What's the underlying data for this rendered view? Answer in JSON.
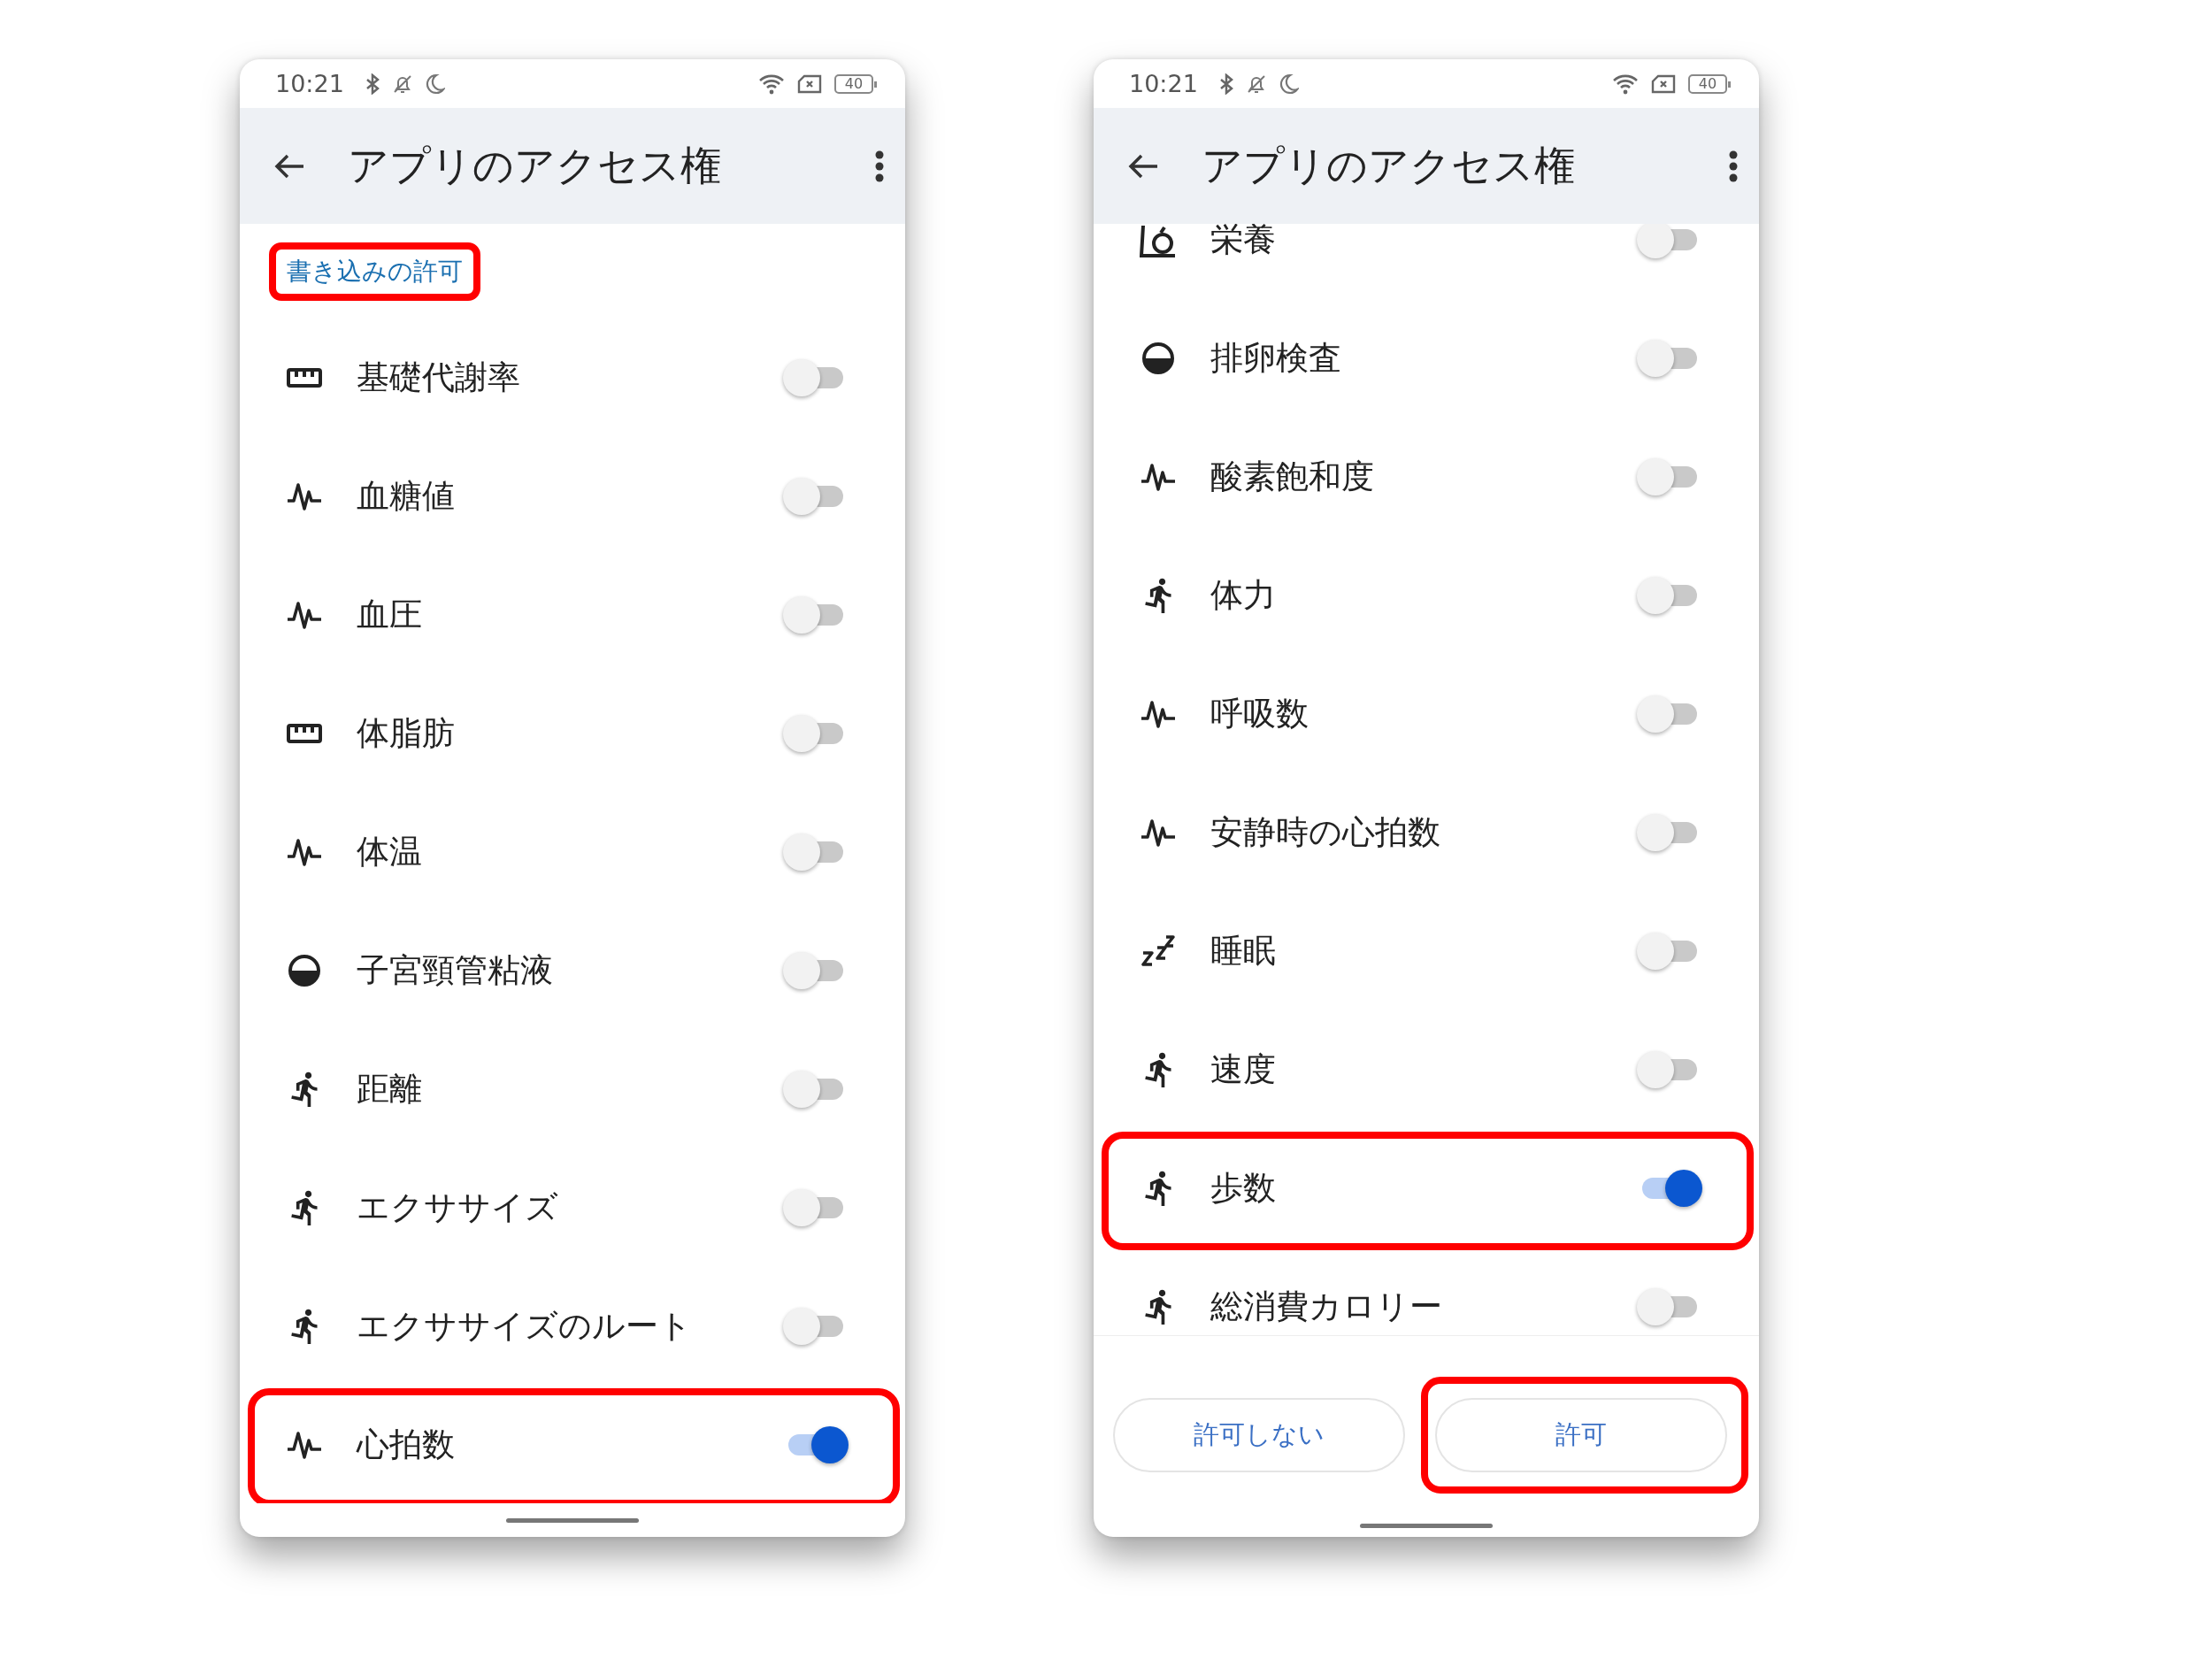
{
  "phones": [
    {
      "status_bar": {
        "time": "10:21",
        "battery": "40"
      },
      "app_bar": {
        "title": "アプリのアクセス権"
      },
      "scrolled": false,
      "section": {
        "title": "書き込みの許可",
        "highlighted": true
      },
      "permissions": [
        {
          "kind": "measurement",
          "label": "基礎代謝率",
          "on": false,
          "highlighted": false
        },
        {
          "kind": "vitals",
          "label": "血糖値",
          "on": false,
          "highlighted": false
        },
        {
          "kind": "vitals",
          "label": "血圧",
          "on": false,
          "highlighted": false
        },
        {
          "kind": "measurement",
          "label": "体脂肪",
          "on": false,
          "highlighted": false
        },
        {
          "kind": "vitals",
          "label": "体温",
          "on": false,
          "highlighted": false
        },
        {
          "kind": "cycle",
          "label": "子宮頸管粘液",
          "on": false,
          "highlighted": false
        },
        {
          "kind": "activity",
          "label": "距離",
          "on": false,
          "highlighted": false
        },
        {
          "kind": "activity",
          "label": "エクササイズ",
          "on": false,
          "highlighted": false
        },
        {
          "kind": "activity",
          "label": "エクササイズのルート",
          "on": false,
          "highlighted": false
        },
        {
          "kind": "vitals",
          "label": "心拍数",
          "on": true,
          "highlighted": true
        }
      ]
    },
    {
      "status_bar": {
        "time": "10:21",
        "battery": "40"
      },
      "app_bar": {
        "title": "アプリのアクセス権"
      },
      "scrolled": true,
      "permissions": [
        {
          "kind": "nutrition",
          "label": "栄養",
          "on": false,
          "highlighted": false
        },
        {
          "kind": "cycle",
          "label": "排卵検査",
          "on": false,
          "highlighted": false
        },
        {
          "kind": "vitals",
          "label": "酸素飽和度",
          "on": false,
          "highlighted": false
        },
        {
          "kind": "activity",
          "label": "体力",
          "on": false,
          "highlighted": false
        },
        {
          "kind": "vitals",
          "label": "呼吸数",
          "on": false,
          "highlighted": false
        },
        {
          "kind": "vitals",
          "label": "安静時の心拍数",
          "on": false,
          "highlighted": false
        },
        {
          "kind": "sleep",
          "label": "睡眠",
          "on": false,
          "highlighted": false
        },
        {
          "kind": "activity",
          "label": "速度",
          "on": false,
          "highlighted": false
        },
        {
          "kind": "activity",
          "label": "歩数",
          "on": true,
          "highlighted": true
        },
        {
          "kind": "activity",
          "label": "総消費カロリー",
          "on": false,
          "highlighted": false
        }
      ],
      "buttons": [
        {
          "label": "許可しない",
          "highlighted": false
        },
        {
          "label": "許可",
          "highlighted": true
        }
      ]
    }
  ]
}
